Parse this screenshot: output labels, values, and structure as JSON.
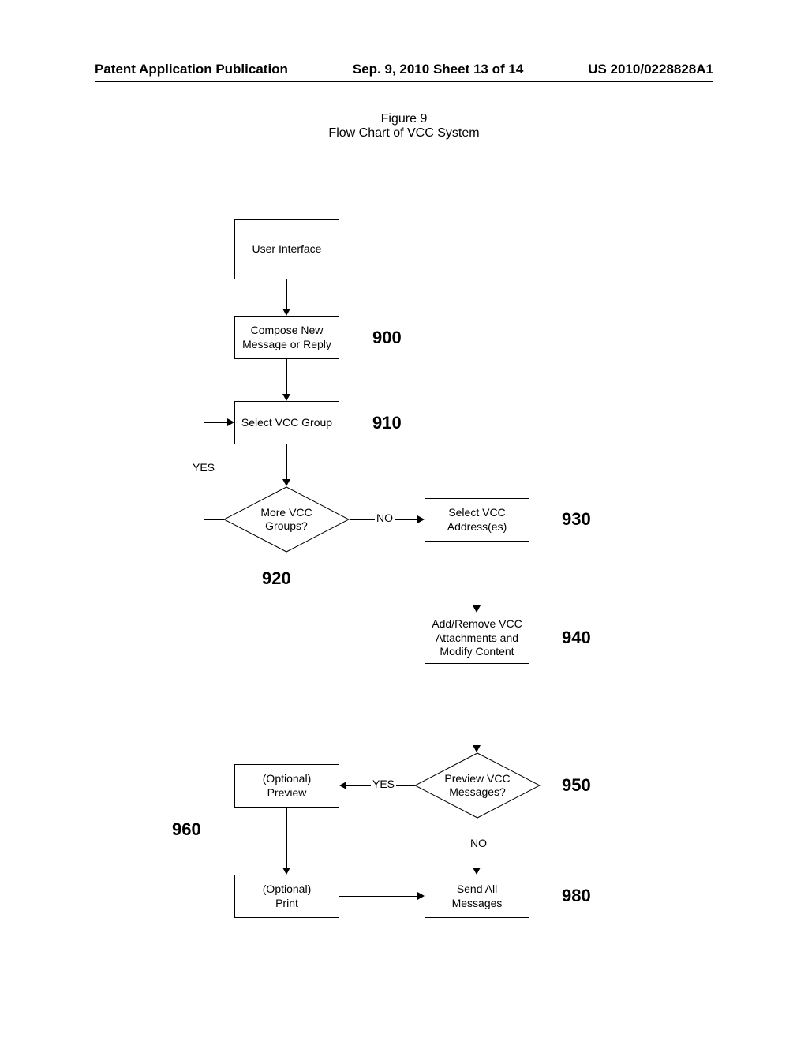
{
  "header": {
    "left": "Patent Application Publication",
    "center": "Sep. 9, 2010   Sheet 13 of 14",
    "right": "US 2010/0228828A1"
  },
  "figure": {
    "number": "Figure 9",
    "title": "Flow Chart of VCC System"
  },
  "nodes": {
    "ui": "User Interface",
    "compose": "Compose New\nMessage or Reply",
    "selectGroup": "Select VCC Group",
    "moreGroups": "More VCC\nGroups?",
    "selectAddr": "Select VCC\nAddress(es)",
    "addRemove": "Add/Remove VCC\nAttachments and\nModify Content",
    "previewQ": "Preview VCC\nMessages?",
    "optPreview": "(Optional)\nPreview",
    "optPrint": "(Optional)\nPrint",
    "sendAll": "Send All\nMessages"
  },
  "refs": {
    "r900": "900",
    "r910": "910",
    "r920": "920",
    "r930": "930",
    "r940": "940",
    "r950": "950",
    "r960": "960",
    "r980": "980"
  },
  "edges": {
    "yes1": "YES",
    "no1": "NO",
    "yes2": "YES",
    "no2": "NO"
  }
}
